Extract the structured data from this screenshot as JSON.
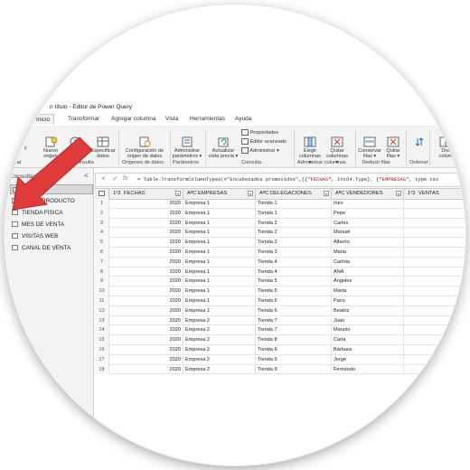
{
  "window": {
    "title": "n título - Editor de Power Query"
  },
  "tabs": [
    {
      "label": "Inicio",
      "active": true
    },
    {
      "label": "Transformar",
      "active": false
    },
    {
      "label": "Agregar columna",
      "active": false
    },
    {
      "label": "Vista",
      "active": false
    },
    {
      "label": "Herramientas",
      "active": false
    },
    {
      "label": "Ayuda",
      "active": false
    }
  ],
  "ribbon": {
    "cerrar_partial": "y",
    "cerrar_group": "rrar",
    "nuevo_line1": "Nuevo",
    "nuevo_line2": "origen",
    "recientes_line1": "rigenes",
    "recientes_line2": "entes",
    "especificar_line1": "Especificar",
    "especificar_line2": "datos",
    "consulta_group_left": "consulta",
    "config_line1": "Configuración de",
    "config_line2": "origen de datos",
    "origenes_group": "Orígenes de datos",
    "admin_line1": "Administrar",
    "admin_line2": "parámetros",
    "parametros_group": "Parámetros",
    "actualizar_line1": "Actualizar",
    "actualizar_line2": "vista previa",
    "propiedades": "Propiedades",
    "editor_avanzado": "Editor avanzado",
    "administrar": "Administrar",
    "consulta_group": "Consulta",
    "elegir_line1": "Elegir",
    "elegir_line2": "columnas",
    "quitar_col_line1": "Quitar",
    "quitar_col_line2": "columnas",
    "admin_columnas_group": "Administrar columnas",
    "conservar_line1": "Conservar",
    "conservar_line2": "filas",
    "quitar_filas_line1": "Quitar",
    "quitar_filas_line2": "filas",
    "reducir_group": "Reducir filas",
    "ordenar_group": "Ordenar",
    "dividir_line1": "Divi",
    "dividir_line2": "colum"
  },
  "sidebar": {
    "header": "Consultas",
    "collapse_glyph": "<",
    "queries": [
      {
        "label": "VENTAS",
        "selected": true
      },
      {
        "label": "VENTA PRODUCTO",
        "selected": false
      },
      {
        "label": "TIENDA FISICA",
        "selected": false
      },
      {
        "label": "MES DE VENTA",
        "selected": false
      },
      {
        "label": "VISITAS WEB",
        "selected": false
      },
      {
        "label": "CANAL DE VENTA",
        "selected": false
      }
    ]
  },
  "formula_bar": {
    "cancel_glyph": "×",
    "confirm_glyph": "✓",
    "fx_glyph": "fx",
    "prefix": "= Table.TransformColumnTypes(#\"Encabezados promovidos\",{{",
    "str1": "\"FECHAS\"",
    "mid": ", Int64.Type}, {",
    "str2": "\"EMPRESAS\"",
    "suffix": ", type tex"
  },
  "table": {
    "columns": [
      {
        "type_icon": "1²3",
        "name": "FECHAS"
      },
      {
        "type_icon": "AᴮC",
        "name": "EMPRESAS"
      },
      {
        "type_icon": "AᴮC",
        "name": "DELEGACIONES"
      },
      {
        "type_icon": "AᴮC",
        "name": "VENDEDORES"
      },
      {
        "type_icon": "1²3",
        "name": "VENTAS"
      }
    ],
    "rows": [
      {
        "n": "1",
        "fecha": "2020",
        "empresa": "Empresa 1",
        "delegacion": "Tienda 1",
        "vendedor": "Ines",
        "ventas": ""
      },
      {
        "n": "2",
        "fecha": "2020",
        "empresa": "Empresa 1",
        "delegacion": "Tienda 1",
        "vendedor": "Pepe",
        "ventas": ""
      },
      {
        "n": "3",
        "fecha": "2020",
        "empresa": "Empresa 1",
        "delegacion": "Tienda 2",
        "vendedor": "Carlos",
        "ventas": ""
      },
      {
        "n": "4",
        "fecha": "2020",
        "empresa": "Empresa 1",
        "delegacion": "Tienda 2",
        "vendedor": "Manuel",
        "ventas": ""
      },
      {
        "n": "5",
        "fecha": "2020",
        "empresa": "Empresa 1",
        "delegacion": "Tienda 3",
        "vendedor": "Alberto",
        "ventas": ""
      },
      {
        "n": "6",
        "fecha": "2020",
        "empresa": "Empresa 1",
        "delegacion": "Tienda 3",
        "vendedor": "Maria",
        "ventas": ""
      },
      {
        "n": "7",
        "fecha": "2020",
        "empresa": "Empresa 1",
        "delegacion": "Tienda 4",
        "vendedor": "Carlota",
        "ventas": ""
      },
      {
        "n": "8",
        "fecha": "2020",
        "empresa": "Empresa 1",
        "delegacion": "Tienda 4",
        "vendedor": "ANA",
        "ventas": ""
      },
      {
        "n": "9",
        "fecha": "2020",
        "empresa": "Empresa 1",
        "delegacion": "Tienda 5",
        "vendedor": "Angeles",
        "ventas": ""
      },
      {
        "n": "10",
        "fecha": "2020",
        "empresa": "Empresa 1",
        "delegacion": "Tienda 5",
        "vendedor": "Marta",
        "ventas": ""
      },
      {
        "n": "11",
        "fecha": "2020",
        "empresa": "Empresa 1",
        "delegacion": "Tienda 6",
        "vendedor": "Paco",
        "ventas": ""
      },
      {
        "n": "12",
        "fecha": "2020",
        "empresa": "Empresa 1",
        "delegacion": "Tienda 6",
        "vendedor": "Beatriz",
        "ventas": ""
      },
      {
        "n": "13",
        "fecha": "2020",
        "empresa": "Empresa 2",
        "delegacion": "Tienda 7",
        "vendedor": "Juan",
        "ventas": ""
      },
      {
        "n": "14",
        "fecha": "2020",
        "empresa": "Empresa 2",
        "delegacion": "Tienda 7",
        "vendedor": "Manolo",
        "ventas": ""
      },
      {
        "n": "15",
        "fecha": "2020",
        "empresa": "Empresa 2",
        "delegacion": "Tienda 8",
        "vendedor": "Carla",
        "ventas": ""
      },
      {
        "n": "16",
        "fecha": "2020",
        "empresa": "Empresa 2",
        "delegacion": "Tienda 8",
        "vendedor": "Bárbara",
        "ventas": ""
      },
      {
        "n": "17",
        "fecha": "2020",
        "empresa": "Empresa 2",
        "delegacion": "Tienda 9",
        "vendedor": "Jorge",
        "ventas": ""
      },
      {
        "n": "18",
        "fecha": "2020",
        "empresa": "Empresa 2",
        "delegacion": "Tienda 9",
        "vendedor": "Fernando",
        "ventas": ""
      }
    ]
  },
  "colors": {
    "arrow": "#e03b3b",
    "selected_query": "#d9d9d9",
    "ribbon_bg": "#f3f3f3"
  }
}
